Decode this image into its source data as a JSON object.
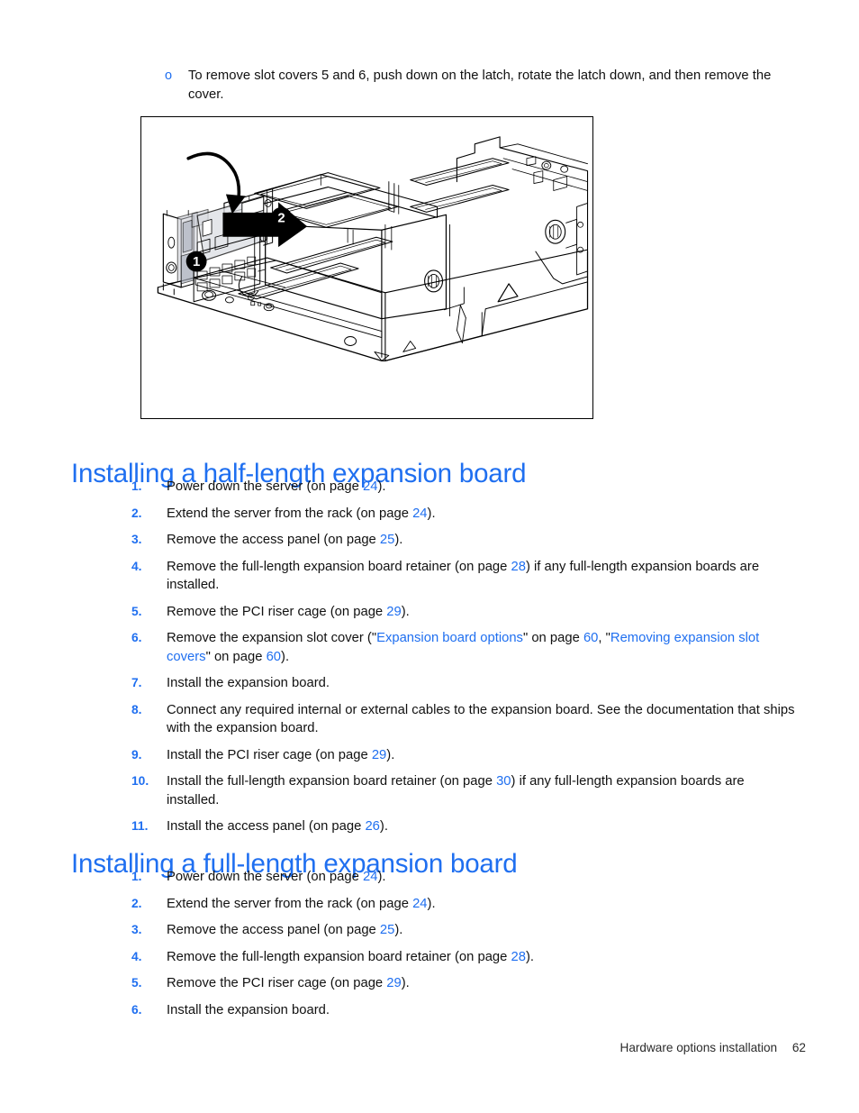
{
  "top_bullet": {
    "marker": "o",
    "text": "To remove slot covers 5 and 6, push down on the latch, rotate the latch down, and then remove the cover."
  },
  "figure": {
    "callouts": [
      "1",
      "2"
    ],
    "alt": "Line drawing of a server chassis with PCI riser cage showing slot cover latch being pushed down and rotated out"
  },
  "sections": [
    {
      "heading": "Installing a half-length expansion board",
      "steps": [
        {
          "num": "1.",
          "parts": [
            {
              "t": "Power down the server (on page ",
              "k": "plain"
            },
            {
              "t": "24",
              "k": "xref"
            },
            {
              "t": ").",
              "k": "plain"
            }
          ]
        },
        {
          "num": "2.",
          "parts": [
            {
              "t": "Extend the server from the rack (on page ",
              "k": "plain"
            },
            {
              "t": "24",
              "k": "xref"
            },
            {
              "t": ").",
              "k": "plain"
            }
          ]
        },
        {
          "num": "3.",
          "parts": [
            {
              "t": "Remove the access panel (on page ",
              "k": "plain"
            },
            {
              "t": "25",
              "k": "xref"
            },
            {
              "t": ").",
              "k": "plain"
            }
          ]
        },
        {
          "num": "4.",
          "parts": [
            {
              "t": "Remove the full-length expansion board retainer (on page ",
              "k": "plain"
            },
            {
              "t": "28",
              "k": "xref"
            },
            {
              "t": ") if any full-length expansion boards are installed.",
              "k": "plain"
            }
          ]
        },
        {
          "num": "5.",
          "parts": [
            {
              "t": "Remove the PCI riser cage (on page ",
              "k": "plain"
            },
            {
              "t": "29",
              "k": "xref"
            },
            {
              "t": ").",
              "k": "plain"
            }
          ]
        },
        {
          "num": "6.",
          "parts": [
            {
              "t": "Remove the expansion slot cover (\"",
              "k": "plain"
            },
            {
              "t": "Expansion board options",
              "k": "link"
            },
            {
              "t": "\" on page ",
              "k": "plain"
            },
            {
              "t": "60",
              "k": "xref"
            },
            {
              "t": ", \"",
              "k": "plain"
            },
            {
              "t": "Removing expansion slot covers",
              "k": "link"
            },
            {
              "t": "\" on page ",
              "k": "plain"
            },
            {
              "t": "60",
              "k": "xref"
            },
            {
              "t": ").",
              "k": "plain"
            }
          ]
        },
        {
          "num": "7.",
          "parts": [
            {
              "t": "Install the expansion board.",
              "k": "plain"
            }
          ]
        },
        {
          "num": "8.",
          "parts": [
            {
              "t": "Connect any required internal or external cables to the expansion board. See the documentation that ships with the expansion board.",
              "k": "plain"
            }
          ]
        },
        {
          "num": "9.",
          "parts": [
            {
              "t": "Install the PCI riser cage (on page ",
              "k": "plain"
            },
            {
              "t": "29",
              "k": "xref"
            },
            {
              "t": ").",
              "k": "plain"
            }
          ]
        },
        {
          "num": "10.",
          "parts": [
            {
              "t": "Install the full-length expansion board retainer (on page ",
              "k": "plain"
            },
            {
              "t": "30",
              "k": "xref"
            },
            {
              "t": ") if any full-length expansion boards are installed.",
              "k": "plain"
            }
          ]
        },
        {
          "num": "11.",
          "parts": [
            {
              "t": "Install the access panel (on page ",
              "k": "plain"
            },
            {
              "t": "26",
              "k": "xref"
            },
            {
              "t": ").",
              "k": "plain"
            }
          ]
        }
      ]
    },
    {
      "heading": "Installing a full-length expansion board",
      "steps": [
        {
          "num": "1.",
          "parts": [
            {
              "t": "Power down the server (on page ",
              "k": "plain"
            },
            {
              "t": "24",
              "k": "xref"
            },
            {
              "t": ").",
              "k": "plain"
            }
          ]
        },
        {
          "num": "2.",
          "parts": [
            {
              "t": "Extend the server from the rack (on page ",
              "k": "plain"
            },
            {
              "t": "24",
              "k": "xref"
            },
            {
              "t": ").",
              "k": "plain"
            }
          ]
        },
        {
          "num": "3.",
          "parts": [
            {
              "t": "Remove the access panel (on page ",
              "k": "plain"
            },
            {
              "t": "25",
              "k": "xref"
            },
            {
              "t": ").",
              "k": "plain"
            }
          ]
        },
        {
          "num": "4.",
          "parts": [
            {
              "t": "Remove the full-length expansion board retainer (on page ",
              "k": "plain"
            },
            {
              "t": "28",
              "k": "xref"
            },
            {
              "t": ").",
              "k": "plain"
            }
          ]
        },
        {
          "num": "5.",
          "parts": [
            {
              "t": "Remove the PCI riser cage (on page ",
              "k": "plain"
            },
            {
              "t": "29",
              "k": "xref"
            },
            {
              "t": ").",
              "k": "plain"
            }
          ]
        },
        {
          "num": "6.",
          "parts": [
            {
              "t": "Install the expansion board.",
              "k": "plain"
            }
          ]
        }
      ]
    }
  ],
  "footer": {
    "chapter": "Hardware options installation",
    "page_number": "62"
  },
  "colors": {
    "heading_blue": "#1f6ff0",
    "link_blue": "#1f6ff0",
    "body_black": "#111111"
  }
}
